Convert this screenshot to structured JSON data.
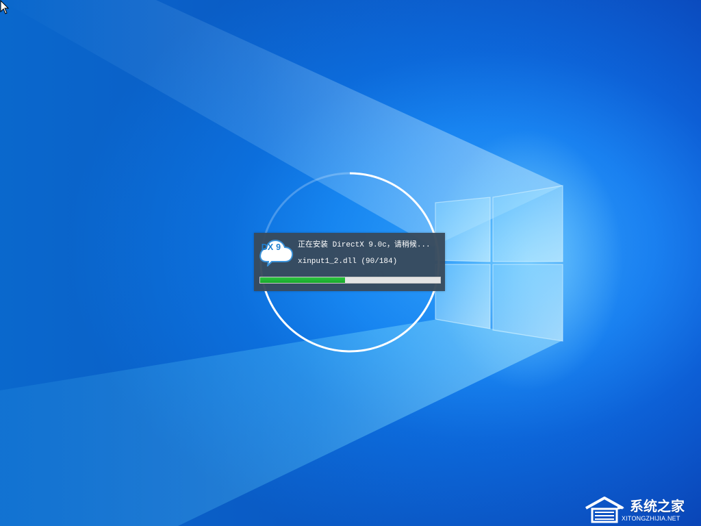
{
  "installer": {
    "logo_text": "DX 9",
    "status_text": "正在安装 DirectX 9.0c，请稍候...",
    "file_text": "xinput1_2.dll (90/184)",
    "progress_fraction": 0.47
  },
  "background": {
    "ghost_percent": "%"
  },
  "watermark": {
    "brand": "系统之家",
    "domain": "XITONGZHIJIA.NET"
  },
  "colors": {
    "dialog_bg": "#384a5c",
    "progress_fill": "#1fb634",
    "progress_track": "#e4e4e4",
    "accent_blue": "#1f7fcf"
  },
  "icons": {
    "cursor": "mouse-pointer-icon",
    "spinner": "loading-ring-icon",
    "installer": "directx-cloud-icon",
    "watermark": "house-logo-icon"
  }
}
